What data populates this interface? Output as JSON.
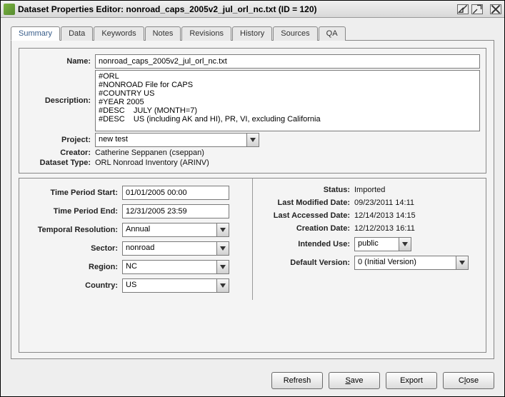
{
  "window": {
    "title": "Dataset Properties Editor: nonroad_caps_2005v2_jul_orl_nc.txt (ID = 120)"
  },
  "tabs": {
    "summary": "Summary",
    "data": "Data",
    "keywords": "Keywords",
    "notes": "Notes",
    "revisions": "Revisions",
    "history": "History",
    "sources": "Sources",
    "qa": "QA"
  },
  "top": {
    "name_label": "Name:",
    "name_value": "nonroad_caps_2005v2_jul_orl_nc.txt",
    "description_label": "Description:",
    "description_value": "#ORL\n#NONROAD File for CAPS\n#COUNTRY US\n#YEAR 2005\n#DESC    JULY (MONTH=7)\n#DESC    US (including AK and HI), PR, VI, excluding California",
    "project_label": "Project:",
    "project_value": "new test",
    "creator_label": "Creator:",
    "creator_value": "Catherine Seppanen (cseppan)",
    "dataset_type_label": "Dataset Type:",
    "dataset_type_value": "ORL Nonroad Inventory (ARINV)"
  },
  "left": {
    "tp_start_label": "Time Period Start:",
    "tp_start_value": "01/01/2005 00:00",
    "tp_end_label": "Time Period End:",
    "tp_end_value": "12/31/2005 23:59",
    "temporal_label": "Temporal Resolution:",
    "temporal_value": "Annual",
    "sector_label": "Sector:",
    "sector_value": "nonroad",
    "region_label": "Region:",
    "region_value": "NC",
    "country_label": "Country:",
    "country_value": "US"
  },
  "right": {
    "status_label": "Status:",
    "status_value": "Imported",
    "last_modified_label": "Last Modified Date:",
    "last_modified_value": "09/23/2011 14:11",
    "last_accessed_label": "Last Accessed Date:",
    "last_accessed_value": "12/14/2013 14:15",
    "creation_label": "Creation Date:",
    "creation_value": "12/12/2013 16:11",
    "intended_use_label": "Intended Use:",
    "intended_use_value": "public",
    "default_version_label": "Default Version:",
    "default_version_value": "0 (Initial Version)"
  },
  "buttons": {
    "refresh": "Refresh",
    "save": "Save",
    "export": "Export",
    "close": "Close"
  }
}
